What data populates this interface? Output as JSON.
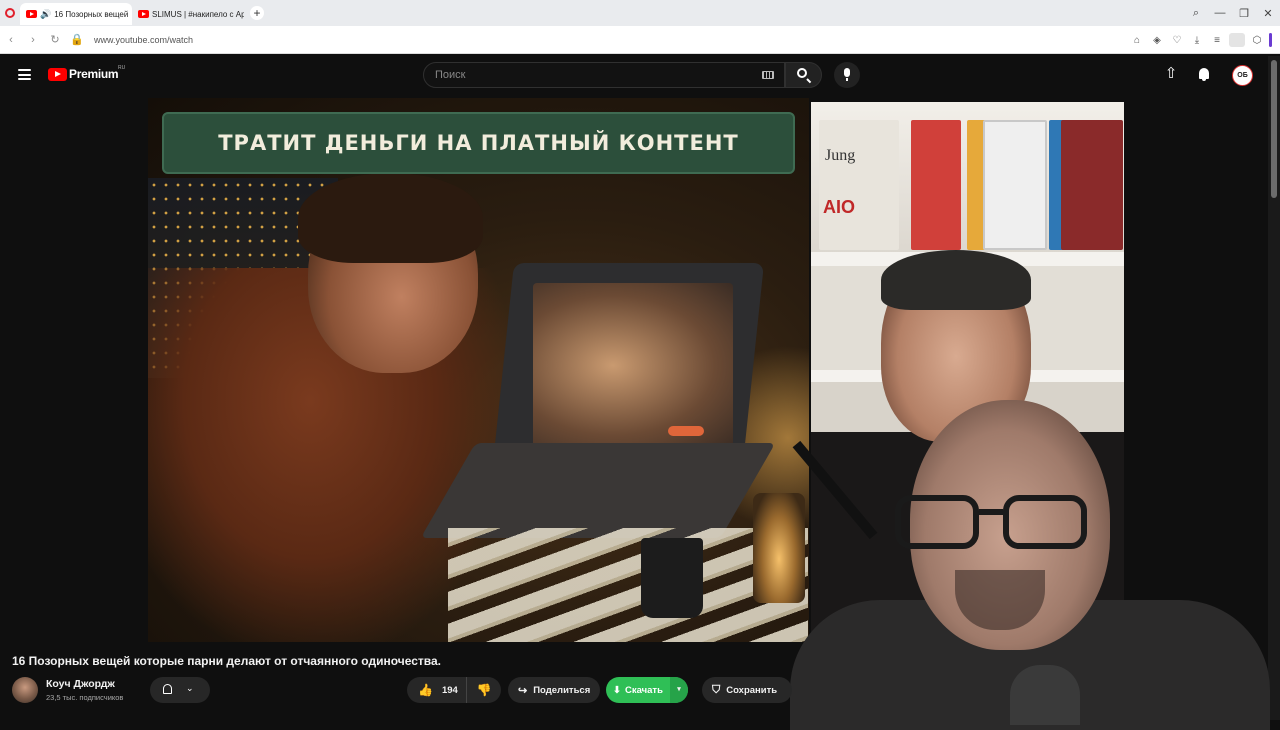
{
  "browser": {
    "tabs": [
      {
        "label": "16 Позорных вещей",
        "active": true
      },
      {
        "label": "SLIMUS | #накипело с Ар",
        "active": false
      }
    ],
    "url": "www.youtube.com/watch",
    "new_tab_symbol": "+"
  },
  "youtube": {
    "logo_text": "Premium",
    "logo_region": "RU",
    "search_placeholder": "Поиск",
    "avatar_initials": "ОБ"
  },
  "video": {
    "banner_text": "ТРАТИТ ДЕНЬГИ НА ПЛАТНЫЙ КОНТЕНТ",
    "title": "16 Позорных вещей которые парни делают от отчаянного одиночества.",
    "channel_name": "Коуч Джордж",
    "channel_subs": "23,5 тыс. подписчиков",
    "likes": "194",
    "share_label": "Поделиться",
    "download_label": "Скачать",
    "save_label": "Сохранить"
  },
  "webcam": {
    "book_label_1": "Jung",
    "book_label_2": "AIO"
  },
  "colors": {
    "youtube_red": "#ff0000",
    "download_green": "#2fbf56",
    "banner_green": "#2c4f3b",
    "opera_red": "#e0202c"
  },
  "icons": [
    "opera-icon",
    "speaker-icon",
    "youtube-favicon",
    "search-icon",
    "mic-icon",
    "upload-icon",
    "bell-icon",
    "like-icon",
    "dislike-icon",
    "share-icon",
    "download-icon",
    "save-icon",
    "hamburger-menu-icon"
  ]
}
